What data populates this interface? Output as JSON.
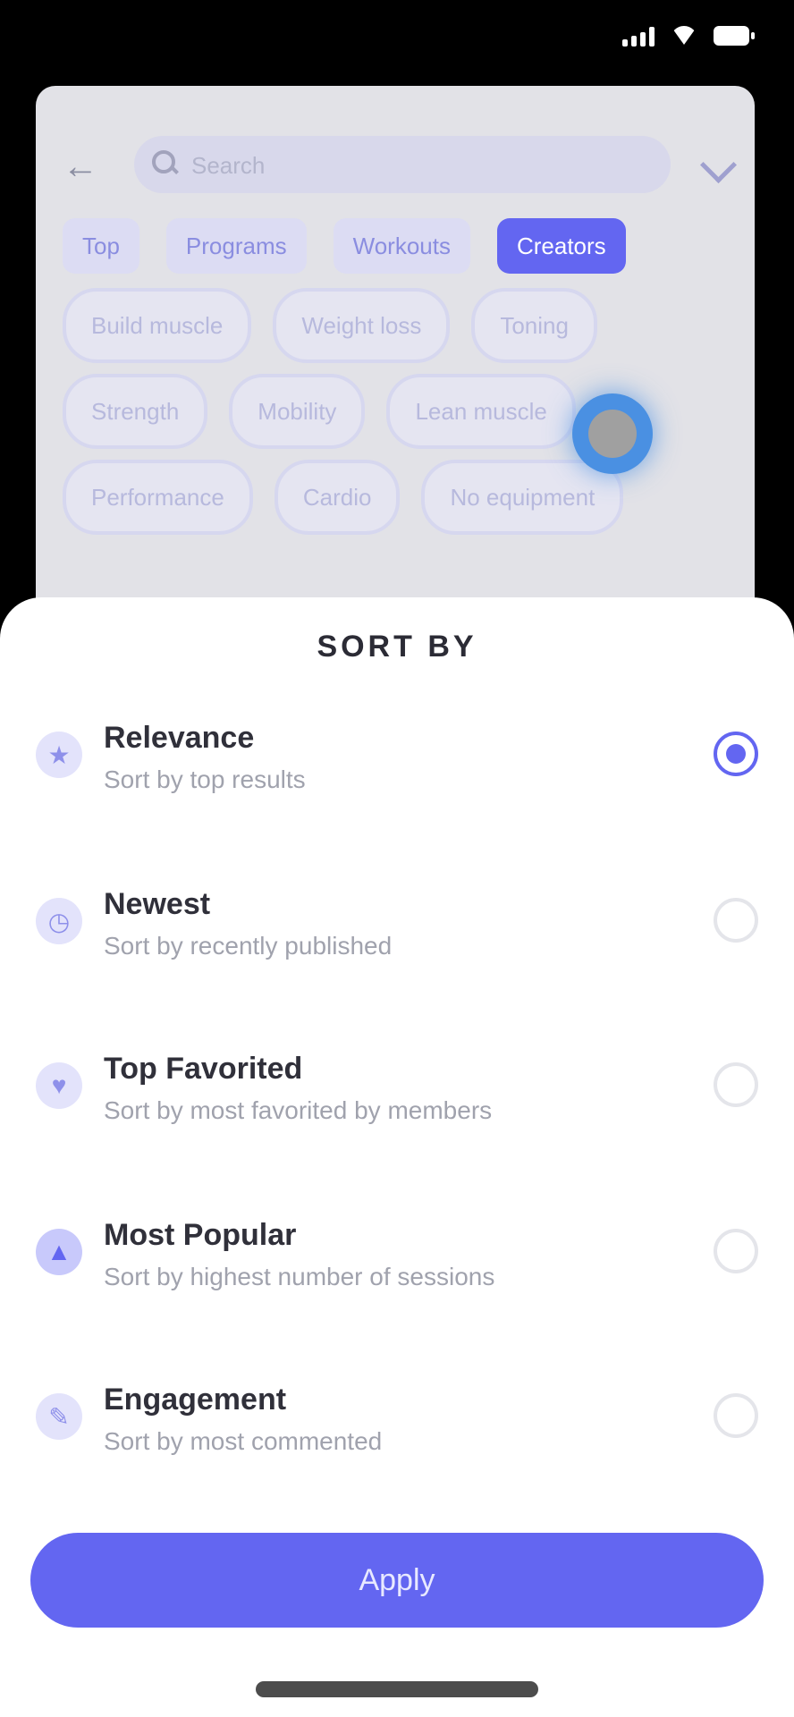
{
  "status": {
    "time": ""
  },
  "background": {
    "search": {
      "placeholder": "Search"
    },
    "tabs": [
      {
        "label": "Top"
      },
      {
        "label": "Programs"
      },
      {
        "label": "Workouts"
      },
      {
        "label": "Creators",
        "active": true
      }
    ],
    "chips": [
      [
        "Build muscle",
        "Weight loss",
        "Toning"
      ],
      [
        "Strength",
        "Mobility",
        "Lean muscle"
      ],
      [
        "Performance",
        "Cardio",
        "No equipment"
      ]
    ]
  },
  "sheet": {
    "title": "SORT BY",
    "options": [
      {
        "title": "Relevance",
        "subtitle": "Sort by top results",
        "selected": true,
        "icon": "star-icon"
      },
      {
        "title": "Newest",
        "subtitle": "Sort by recently published",
        "selected": false,
        "icon": "clock-icon"
      },
      {
        "title": "Top Favorited",
        "subtitle": "Sort by most favorited by members",
        "selected": false,
        "icon": "heart-icon"
      },
      {
        "title": "Most Popular",
        "subtitle": "Sort by highest number of sessions",
        "selected": false,
        "icon": "fire-icon"
      },
      {
        "title": "Engagement",
        "subtitle": "Sort by most commented",
        "selected": false,
        "icon": "comment-icon"
      }
    ],
    "apply_label": "Apply"
  },
  "colors": {
    "accent": "#6366f1"
  }
}
